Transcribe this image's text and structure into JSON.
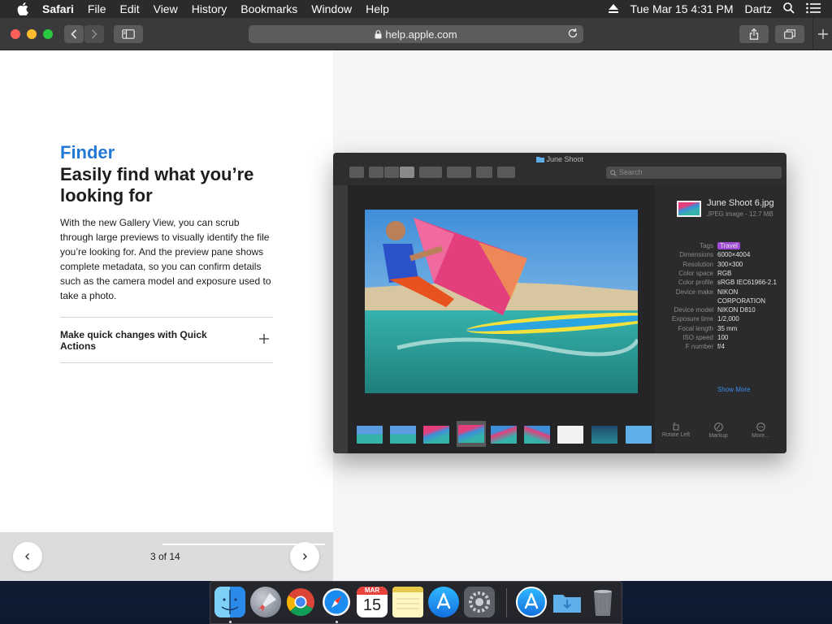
{
  "menubar": {
    "items": [
      "Safari",
      "File",
      "Edit",
      "View",
      "History",
      "Bookmarks",
      "Window",
      "Help"
    ],
    "clock": "Tue Mar 15  4:31 PM",
    "user": "Dartz"
  },
  "browser": {
    "url": "help.apple.com"
  },
  "page": {
    "eyebrow": "Finder",
    "headline": "Easily find what you’re looking for",
    "body": "With the new Gallery View, you can scrub through large previews to visually identify the file you’re looking for. And the preview pane shows complete metadata, so you can confirm details such as the camera model and exposure used to take a photo.",
    "accordion_label": "Make quick changes with Quick Actions",
    "pager": "3 of 14"
  },
  "finder": {
    "window_title": "June Shoot",
    "search_placeholder": "Search",
    "file_name": "June Shoot 6.jpg",
    "file_sub": "JPEG image - 12.7 MB",
    "metadata": [
      {
        "k": "Tags",
        "v": "Travel",
        "tag": true
      },
      {
        "k": "Dimensions",
        "v": "6000×4004"
      },
      {
        "k": "Resolution",
        "v": "300×300"
      },
      {
        "k": "Color space",
        "v": "RGB"
      },
      {
        "k": "Color profile",
        "v": "sRGB IEC61966-2.1"
      },
      {
        "k": "Device make",
        "v": "NIKON"
      },
      {
        "k": "",
        "v": "CORPORATION"
      },
      {
        "k": "Device model",
        "v": "NIKON D810"
      },
      {
        "k": "Exposure time",
        "v": "1/2,000"
      },
      {
        "k": "Focal length",
        "v": "35 mm"
      },
      {
        "k": "ISO speed",
        "v": "100"
      },
      {
        "k": "F number",
        "v": "f/4"
      }
    ],
    "show_more": "Show More",
    "actions": [
      "Rotate Left",
      "Markup",
      "More..."
    ]
  },
  "dock": {
    "calendar_month": "MAR",
    "calendar_day": "15"
  },
  "colors": {
    "accent": "#2478d6",
    "tag": "#a04ad6"
  }
}
